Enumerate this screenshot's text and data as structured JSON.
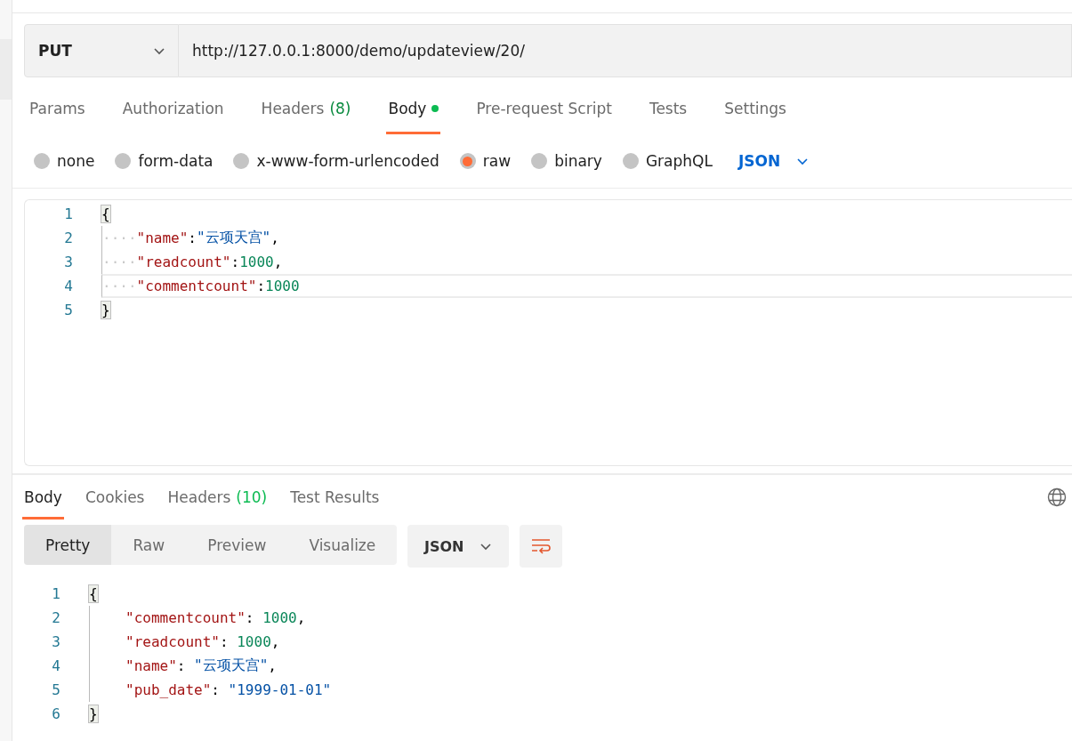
{
  "request": {
    "method": "PUT",
    "url": "http://127.0.0.1:8000/demo/updateview/20/"
  },
  "request_tabs": [
    {
      "label": "Params",
      "selected": false
    },
    {
      "label": "Authorization",
      "selected": false
    },
    {
      "label": "Headers",
      "count": "(8)",
      "selected": false
    },
    {
      "label": "Body",
      "dot": true,
      "selected": true
    },
    {
      "label": "Pre-request Script",
      "selected": false
    },
    {
      "label": "Tests",
      "selected": false
    },
    {
      "label": "Settings",
      "selected": false
    }
  ],
  "body_types": [
    {
      "label": "none",
      "selected": false
    },
    {
      "label": "form-data",
      "selected": false
    },
    {
      "label": "x-www-form-urlencoded",
      "selected": false
    },
    {
      "label": "raw",
      "selected": true
    },
    {
      "label": "binary",
      "selected": false
    },
    {
      "label": "GraphQL",
      "selected": false
    }
  ],
  "body_language": "JSON",
  "request_body": [
    {
      "number": "1",
      "current": false,
      "tokens": [
        {
          "kind": "brace",
          "text": "{"
        }
      ]
    },
    {
      "number": "2",
      "current": false,
      "tokens": [
        {
          "kind": "space",
          "text": "····"
        },
        {
          "kind": "key",
          "text": "\"name\""
        },
        {
          "kind": "punct",
          "text": ":"
        },
        {
          "kind": "string",
          "text": "\"云项天宫\""
        },
        {
          "kind": "punct",
          "text": ","
        }
      ]
    },
    {
      "number": "3",
      "current": false,
      "tokens": [
        {
          "kind": "space",
          "text": "····"
        },
        {
          "kind": "key",
          "text": "\"readcount\""
        },
        {
          "kind": "punct",
          "text": ":"
        },
        {
          "kind": "number",
          "text": "1000"
        },
        {
          "kind": "punct",
          "text": ","
        }
      ]
    },
    {
      "number": "4",
      "current": true,
      "tokens": [
        {
          "kind": "space",
          "text": "····"
        },
        {
          "kind": "key",
          "text": "\"commentcount\""
        },
        {
          "kind": "punct",
          "text": ":"
        },
        {
          "kind": "number",
          "text": "1000"
        }
      ]
    },
    {
      "number": "5",
      "current": false,
      "tokens": [
        {
          "kind": "brace",
          "text": "}"
        }
      ]
    }
  ],
  "response_tabs": [
    {
      "label": "Body",
      "selected": true
    },
    {
      "label": "Cookies",
      "selected": false
    },
    {
      "label": "Headers",
      "count": "(10)",
      "selected": false
    },
    {
      "label": "Test Results",
      "selected": false
    }
  ],
  "view_modes": [
    {
      "label": "Pretty",
      "selected": true
    },
    {
      "label": "Raw",
      "selected": false
    },
    {
      "label": "Preview",
      "selected": false
    },
    {
      "label": "Visualize",
      "selected": false
    }
  ],
  "response_format": "JSON",
  "response_body": [
    {
      "number": "1",
      "indent": false,
      "tokens": [
        {
          "kind": "brace",
          "text": "{"
        }
      ]
    },
    {
      "number": "2",
      "indent": true,
      "tokens": [
        {
          "kind": "key",
          "text": "\"commentcount\""
        },
        {
          "kind": "punct",
          "text": ": "
        },
        {
          "kind": "number",
          "text": "1000"
        },
        {
          "kind": "punct",
          "text": ","
        }
      ]
    },
    {
      "number": "3",
      "indent": true,
      "tokens": [
        {
          "kind": "key",
          "text": "\"readcount\""
        },
        {
          "kind": "punct",
          "text": ": "
        },
        {
          "kind": "number",
          "text": "1000"
        },
        {
          "kind": "punct",
          "text": ","
        }
      ]
    },
    {
      "number": "4",
      "indent": true,
      "tokens": [
        {
          "kind": "key",
          "text": "\"name\""
        },
        {
          "kind": "punct",
          "text": ": "
        },
        {
          "kind": "string",
          "text": "\"云项天宫\""
        },
        {
          "kind": "punct",
          "text": ","
        }
      ]
    },
    {
      "number": "5",
      "indent": true,
      "tokens": [
        {
          "kind": "key",
          "text": "\"pub_date\""
        },
        {
          "kind": "punct",
          "text": ": "
        },
        {
          "kind": "string",
          "text": "\"1999-01-01\""
        }
      ]
    },
    {
      "number": "6",
      "indent": false,
      "tokens": [
        {
          "kind": "brace",
          "text": "}"
        }
      ]
    }
  ]
}
